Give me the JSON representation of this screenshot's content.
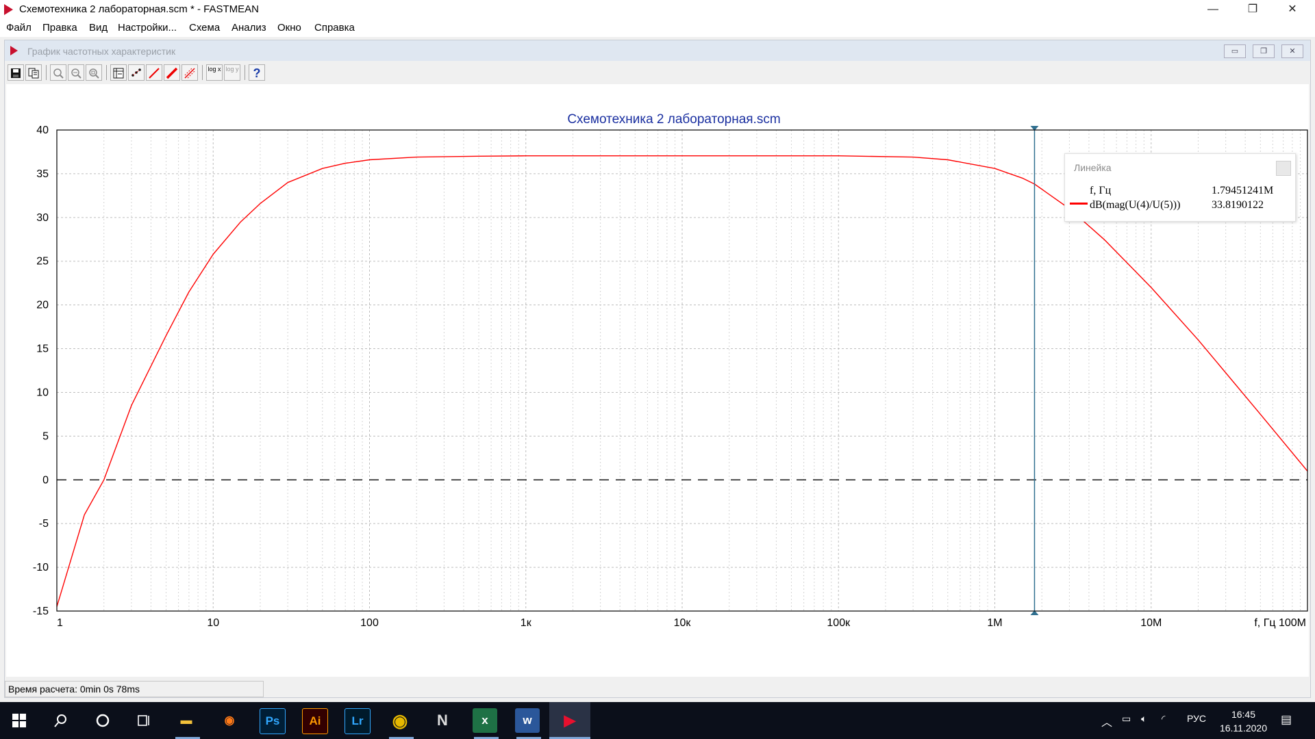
{
  "window": {
    "title": "Схемотехника 2 лабораторная.scm * - FASTMEAN",
    "minimize": "—",
    "restore": "❐",
    "close": "✕"
  },
  "menu": [
    "Файл",
    "Правка",
    "Вид",
    "Настройки...",
    "Схема",
    "Анализ",
    "Окно",
    "Справка"
  ],
  "subwindow": {
    "title": "График частотных характеристик"
  },
  "toolbar": {
    "log_x": "log x",
    "log_y": "log y",
    "help": "?"
  },
  "chart_data": {
    "type": "line",
    "title": "Схемотехника 2 лабораторная.scm",
    "xlabel": "f, Гц",
    "ylabel": "",
    "x_scale": "log",
    "xlim": [
      1,
      100000000
    ],
    "ylim": [
      -15,
      40
    ],
    "x_ticks": [
      {
        "value": 1,
        "label": "1"
      },
      {
        "value": 10,
        "label": "10"
      },
      {
        "value": 100,
        "label": "100"
      },
      {
        "value": 1000,
        "label": "1к"
      },
      {
        "value": 10000,
        "label": "10к"
      },
      {
        "value": 100000,
        "label": "100к"
      },
      {
        "value": 1000000,
        "label": "1М"
      },
      {
        "value": 10000000,
        "label": "10М"
      },
      {
        "value": 100000000,
        "label": "100M"
      }
    ],
    "y_ticks": [
      40,
      35,
      30,
      25,
      20,
      15,
      10,
      5,
      0,
      -5,
      -10,
      -15
    ],
    "grid": true,
    "series": [
      {
        "name": "dB(mag(U(4)/U(5)))",
        "color": "#ff0000",
        "points": [
          [
            1,
            -14.5
          ],
          [
            1.5,
            -4.0
          ],
          [
            2,
            0.0
          ],
          [
            3,
            8.5
          ],
          [
            5,
            16.5
          ],
          [
            7,
            21.5
          ],
          [
            10,
            25.8
          ],
          [
            15,
            29.5
          ],
          [
            20,
            31.6
          ],
          [
            30,
            34.0
          ],
          [
            50,
            35.6
          ],
          [
            70,
            36.2
          ],
          [
            100,
            36.6
          ],
          [
            200,
            36.9
          ],
          [
            500,
            37.0
          ],
          [
            1000,
            37.05
          ],
          [
            10000,
            37.05
          ],
          [
            100000,
            37.05
          ],
          [
            300000,
            36.9
          ],
          [
            500000,
            36.6
          ],
          [
            1000000,
            35.6
          ],
          [
            1500000,
            34.5
          ],
          [
            1794512.41,
            33.82
          ],
          [
            3000000,
            31.0
          ],
          [
            5000000,
            27.5
          ],
          [
            10000000,
            22.0
          ],
          [
            20000000,
            16.0
          ],
          [
            50000000,
            7.5
          ],
          [
            100000000,
            1.0
          ]
        ]
      }
    ],
    "reference_line": {
      "y": 0,
      "style": "dashed",
      "color": "#000000"
    },
    "cursor": {
      "x": 1794512.41,
      "color": "#2f6f8f"
    },
    "legend_placement": "top-right"
  },
  "readout": {
    "title": "Линейка",
    "freq_label": "f, Гц",
    "freq_value": "1.79451241M",
    "series_label": "dB(mag(U(4)/U(5)))",
    "series_value": "33.8190122"
  },
  "status": {
    "calc_time": "Время расчета: 0min 0s 78ms"
  },
  "taskbar": {
    "apps": [
      {
        "name": "explorer",
        "label": "▬"
      },
      {
        "name": "browser-app",
        "label": "◉"
      },
      {
        "name": "photoshop",
        "label": "Ps"
      },
      {
        "name": "illustrator",
        "label": "Ai"
      },
      {
        "name": "lightroom",
        "label": "Lr"
      },
      {
        "name": "chrome",
        "label": "◉"
      },
      {
        "name": "notion",
        "label": "N"
      },
      {
        "name": "excel",
        "label": "x"
      },
      {
        "name": "word",
        "label": "w"
      },
      {
        "name": "fastmean",
        "label": "▶"
      }
    ],
    "lang": "РУС",
    "time": "16:45",
    "date": "16.11.2020"
  }
}
